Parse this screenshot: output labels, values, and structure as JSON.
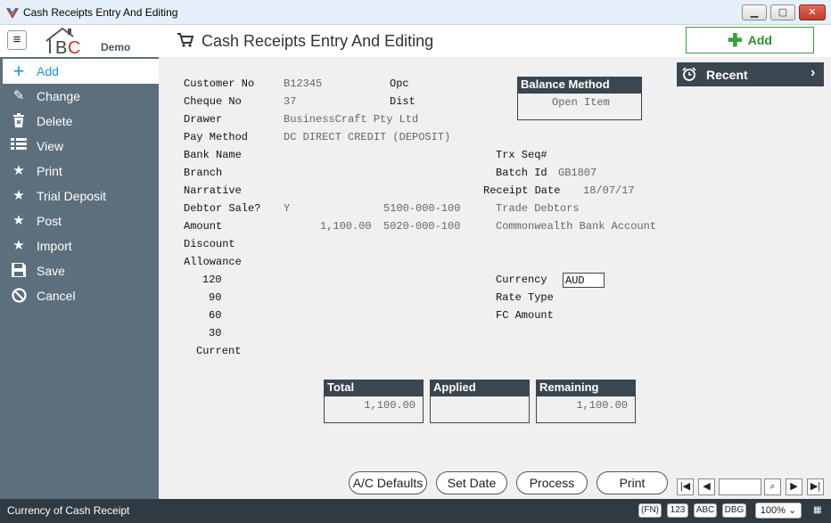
{
  "window": {
    "title": "Cash Receipts Entry And Editing"
  },
  "header": {
    "logo_demo": "Demo",
    "page_title": "Cash Receipts Entry And Editing",
    "add_label": "Add"
  },
  "sidebar": {
    "items": [
      {
        "label": "Add",
        "icon": "plus-icon"
      },
      {
        "label": "Change",
        "icon": "pencil-icon"
      },
      {
        "label": "Delete",
        "icon": "trash-icon"
      },
      {
        "label": "View",
        "icon": "list-icon"
      },
      {
        "label": "Print",
        "icon": "star-icon"
      },
      {
        "label": "Trial Deposit",
        "icon": "star-icon"
      },
      {
        "label": "Post",
        "icon": "star-icon"
      },
      {
        "label": "Import",
        "icon": "star-icon"
      },
      {
        "label": "Save",
        "icon": "save-icon"
      },
      {
        "label": "Cancel",
        "icon": "cancel-icon"
      }
    ]
  },
  "form": {
    "customer_no_label": "Customer No",
    "customer_no": "B12345",
    "opc_label": "Opc",
    "cheque_no_label": "Cheque No",
    "cheque_no": "37",
    "dist_label": "Dist",
    "drawer_label": "Drawer",
    "drawer": "BusinessCraft Pty Ltd",
    "pay_method_label": "Pay Method",
    "pay_method": "DC DIRECT CREDIT (DEPOSIT)",
    "bank_name_label": "Bank Name",
    "branch_label": "Branch",
    "narrative_label": "Narrative",
    "debtor_sale_label": "Debtor Sale?",
    "debtor_sale": "Y",
    "debtor_account": "5100-000-100",
    "debtor_account_name": "Trade Debtors",
    "amount_label": "Amount",
    "amount": "1,100.00",
    "amount_account": "5020-000-100",
    "amount_account_name": "Commonwealth Bank Account",
    "discount_label": "Discount",
    "allowance_label": "Allowance",
    "aging": [
      "120",
      "90",
      "60",
      "30",
      "Current"
    ],
    "trx_seq_label": "Trx Seq#",
    "batch_id_label": "Batch Id",
    "batch_id": "GB1807",
    "receipt_date_label": "Receipt Date",
    "receipt_date": "18/07/17",
    "currency_label": "Currency",
    "currency": "AUD",
    "rate_type_label": "Rate Type",
    "fc_amount_label": "FC Amount"
  },
  "balance_method": {
    "title": "Balance Method",
    "value": "Open Item"
  },
  "recent": {
    "label": "Recent"
  },
  "totals": {
    "total_label": "Total",
    "total": "1,100.00",
    "applied_label": "Applied",
    "applied": "",
    "remaining_label": "Remaining",
    "remaining": "1,100.00"
  },
  "actions": {
    "ac_defaults": "A/C Defaults",
    "set_date": "Set Date",
    "process": "Process",
    "print": "Print"
  },
  "status": {
    "message": "Currency of Cash Receipt",
    "fn": "(FN)",
    "num": "123",
    "abc": "ABC",
    "dbg": "DBG",
    "zoom": "100%"
  },
  "colors": {
    "sidebar": "#5d6f7c",
    "dark": "#3a4650",
    "accent_green": "#3aa13a",
    "accent_blue": "#1b95e0"
  }
}
